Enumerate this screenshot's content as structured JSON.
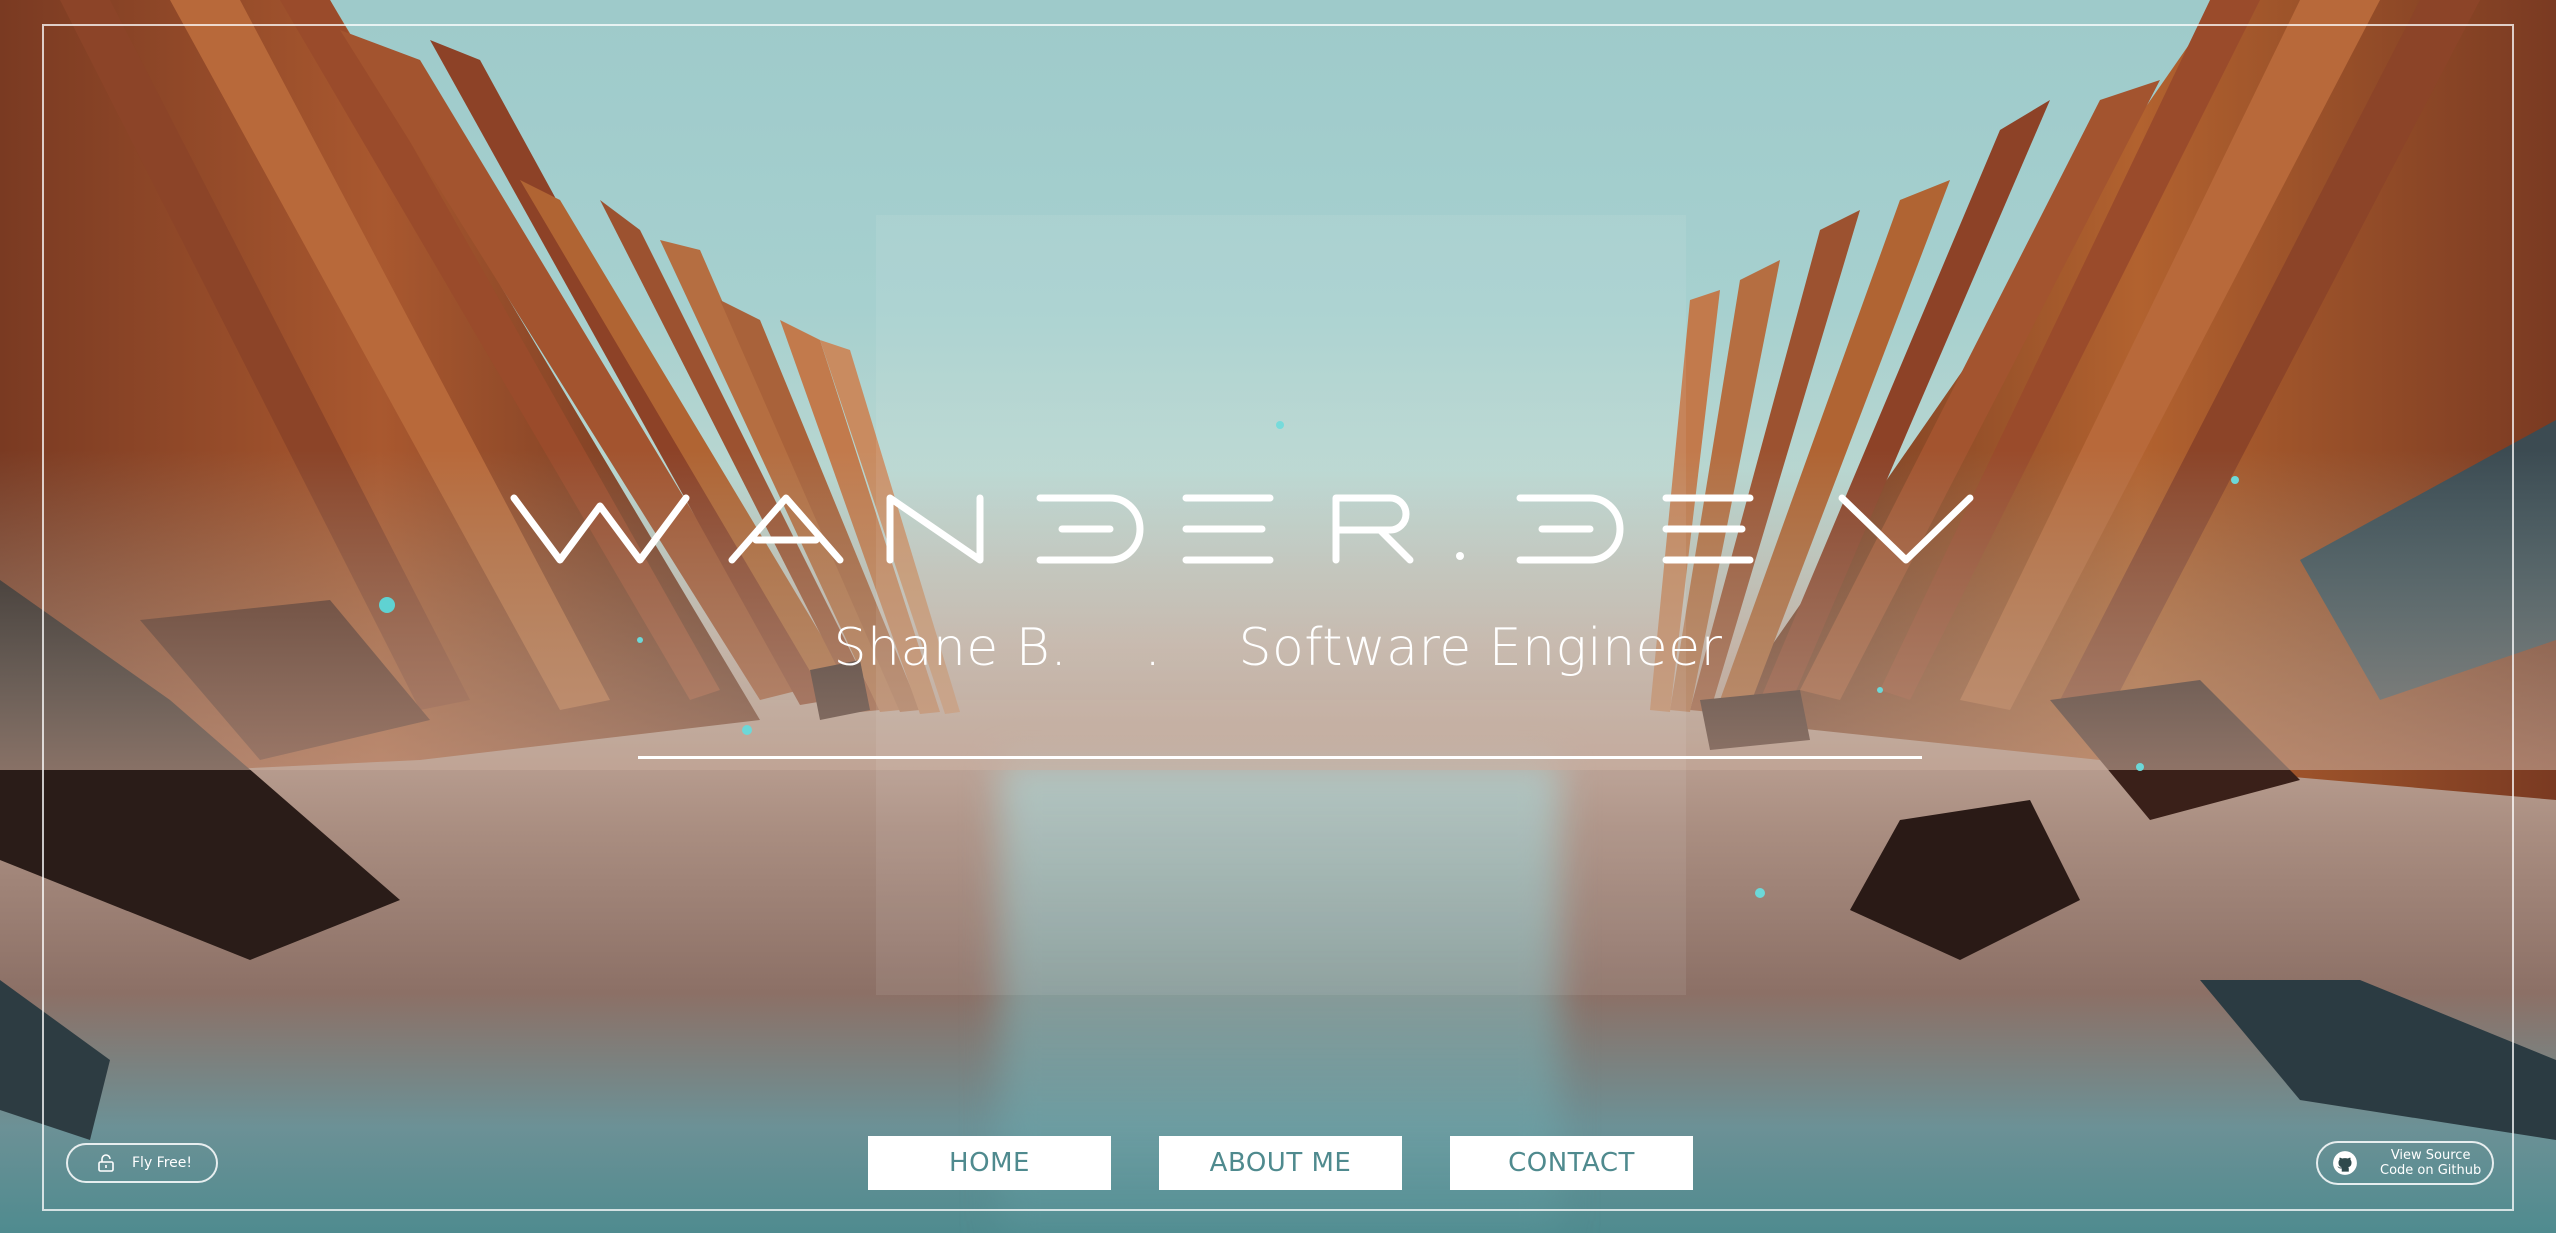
{
  "site": {
    "logo_text": "WANDER.DEV",
    "author": "Shane B.",
    "separator": ".",
    "role": "Software Engineer"
  },
  "nav": {
    "items": [
      {
        "label": "HOME"
      },
      {
        "label": "ABOUT ME"
      },
      {
        "label": "CONTACT"
      }
    ]
  },
  "fly_button": {
    "label": "Fly Free!",
    "icon": "unlock-icon"
  },
  "github_button": {
    "line1": "View Source",
    "line2": "Code on Github",
    "icon": "github-icon"
  },
  "colors": {
    "sky": "#9fc4c4",
    "pillars": "#a4532f",
    "nav_text": "#4f8a8e",
    "accent_white": "#ffffff"
  }
}
